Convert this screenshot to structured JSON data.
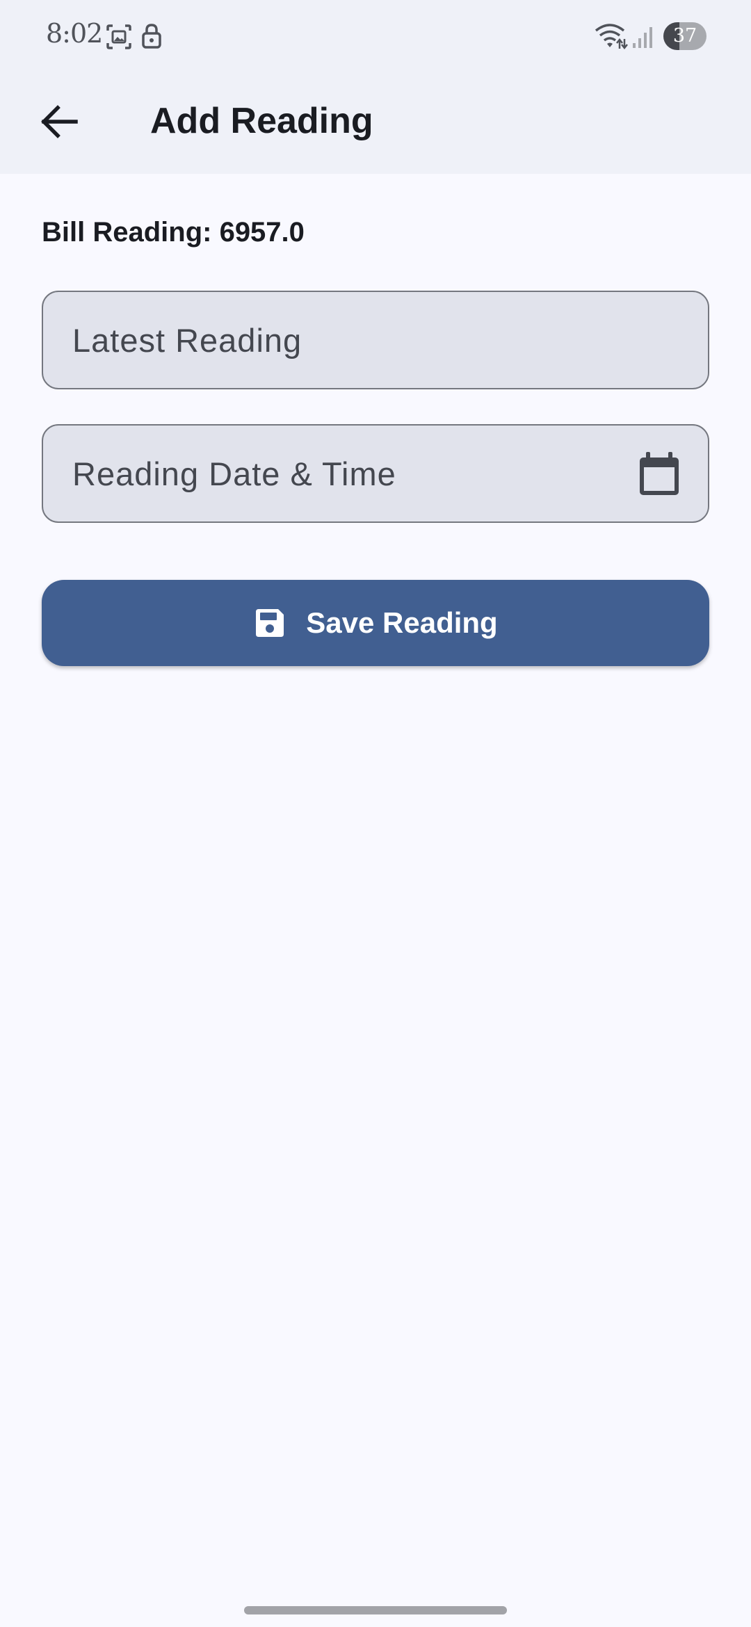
{
  "status_bar": {
    "time": "8:02",
    "battery_level": "37",
    "battery_fraction": 0.37,
    "icons": [
      "screenshot-icon",
      "lock-icon",
      "wifi-icon",
      "signal-icon",
      "battery-icon"
    ]
  },
  "app_bar": {
    "back_icon": "arrow-back-icon",
    "title": "Add Reading",
    "background": "#eff1f8"
  },
  "form": {
    "bill_reading_text": "Bill Reading: 6957.0",
    "latest_reading_label": "Latest Reading",
    "latest_reading_value": "",
    "reading_datetime_label": "Reading Date & Time",
    "reading_datetime_value": "",
    "calendar_icon": "calendar-icon",
    "save_button_label": "Save Reading",
    "save_icon": "save-icon"
  },
  "colors": {
    "primary": "#415f91",
    "surface": "#f9f9ff",
    "field_fill": "#e1e3ec",
    "outline": "#74777f"
  }
}
